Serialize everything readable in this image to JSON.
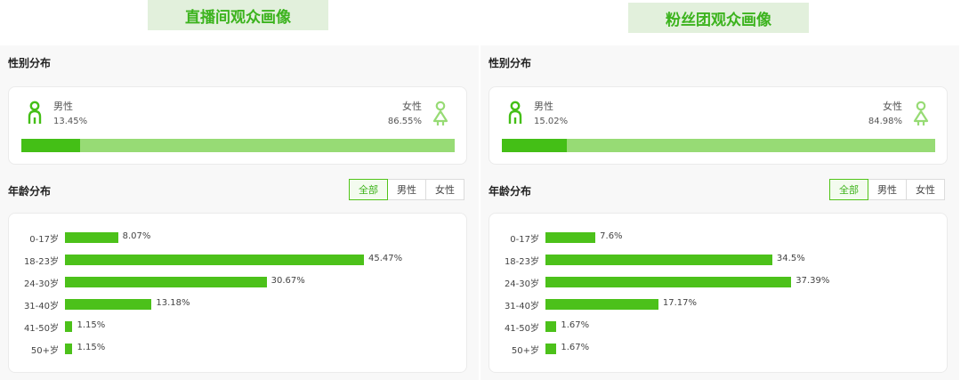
{
  "headers": {
    "left": "直播间观众画像",
    "right": "粉丝团观众画像"
  },
  "colors": {
    "accent": "#44bf16",
    "female": "#97db75",
    "header_bg": "#e2f0dc"
  },
  "panels": [
    {
      "gender_title": "性别分布",
      "male_label": "男性",
      "male_value": "13.45%",
      "male_fraction": 0.1345,
      "female_label": "女性",
      "female_value": "86.55%",
      "age_title": "年龄分布",
      "tabs": [
        "全部",
        "男性",
        "女性"
      ],
      "active_tab": "全部",
      "ages": [
        {
          "label": "0-17岁",
          "value": 8.07,
          "text": "8.07%"
        },
        {
          "label": "18-23岁",
          "value": 45.47,
          "text": "45.47%"
        },
        {
          "label": "24-30岁",
          "value": 30.67,
          "text": "30.67%"
        },
        {
          "label": "31-40岁",
          "value": 13.18,
          "text": "13.18%"
        },
        {
          "label": "41-50岁",
          "value": 1.15,
          "text": "1.15%"
        },
        {
          "label": "50+岁",
          "value": 1.15,
          "text": "1.15%"
        }
      ]
    },
    {
      "gender_title": "性别分布",
      "male_label": "男性",
      "male_value": "15.02%",
      "male_fraction": 0.1502,
      "female_label": "女性",
      "female_value": "84.98%",
      "age_title": "年龄分布",
      "tabs": [
        "全部",
        "男性",
        "女性"
      ],
      "active_tab": "全部",
      "ages": [
        {
          "label": "0-17岁",
          "value": 7.6,
          "text": "7.6%"
        },
        {
          "label": "18-23岁",
          "value": 34.5,
          "text": "34.5%"
        },
        {
          "label": "24-30岁",
          "value": 37.39,
          "text": "37.39%"
        },
        {
          "label": "31-40岁",
          "value": 17.17,
          "text": "17.17%"
        },
        {
          "label": "41-50岁",
          "value": 1.67,
          "text": "1.67%"
        },
        {
          "label": "50+岁",
          "value": 1.67,
          "text": "1.67%"
        }
      ]
    }
  ]
}
